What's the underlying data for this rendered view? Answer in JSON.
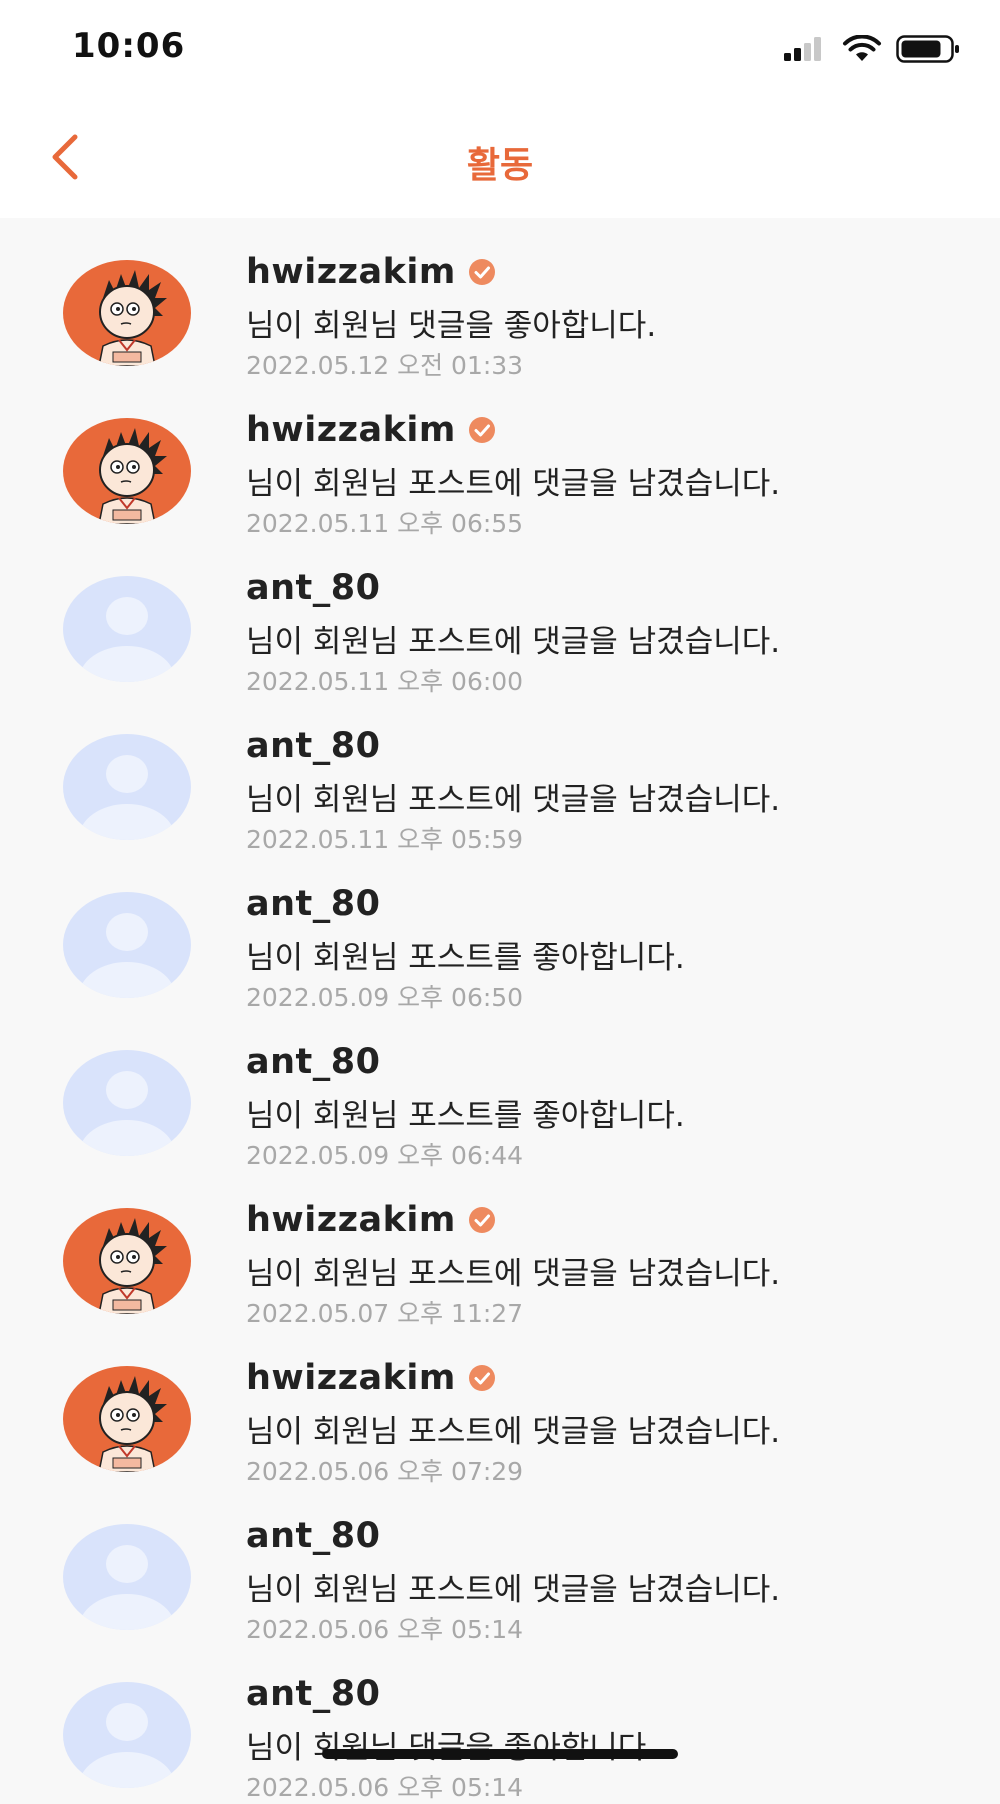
{
  "status_bar": {
    "time": "10:06"
  },
  "header": {
    "title": "활동",
    "back_icon": "chevron-left-icon"
  },
  "colors": {
    "accent": "#e8693a",
    "default_avatar_bg": "#d9e3fb",
    "default_avatar_fg": "#edf2fd"
  },
  "activities": [
    {
      "username": "hwizzakim",
      "verified": true,
      "avatar": "cartoon",
      "message": "님이 회원님 댓글을 좋아합니다.",
      "time": "2022.05.12 오전 01:33"
    },
    {
      "username": "hwizzakim",
      "verified": true,
      "avatar": "cartoon",
      "message": "님이 회원님 포스트에 댓글을 남겼습니다.",
      "time": "2022.05.11 오후 06:55"
    },
    {
      "username": "ant_80",
      "verified": false,
      "avatar": "default",
      "message": "님이 회원님 포스트에 댓글을 남겼습니다.",
      "time": "2022.05.11 오후 06:00"
    },
    {
      "username": "ant_80",
      "verified": false,
      "avatar": "default",
      "message": "님이 회원님 포스트에 댓글을 남겼습니다.",
      "time": "2022.05.11 오후 05:59"
    },
    {
      "username": "ant_80",
      "verified": false,
      "avatar": "default",
      "message": "님이 회원님 포스트를 좋아합니다.",
      "time": "2022.05.09 오후 06:50"
    },
    {
      "username": "ant_80",
      "verified": false,
      "avatar": "default",
      "message": "님이 회원님 포스트를 좋아합니다.",
      "time": "2022.05.09 오후 06:44"
    },
    {
      "username": "hwizzakim",
      "verified": true,
      "avatar": "cartoon",
      "message": "님이 회원님 포스트에 댓글을 남겼습니다.",
      "time": "2022.05.07 오후 11:27"
    },
    {
      "username": "hwizzakim",
      "verified": true,
      "avatar": "cartoon",
      "message": "님이 회원님 포스트에 댓글을 남겼습니다.",
      "time": "2022.05.06 오후 07:29"
    },
    {
      "username": "ant_80",
      "verified": false,
      "avatar": "default",
      "message": "님이 회원님 포스트에 댓글을 남겼습니다.",
      "time": "2022.05.06 오후 05:14"
    },
    {
      "username": "ant_80",
      "verified": false,
      "avatar": "default",
      "message": "님이 회원님 댓글을 좋아합니다.",
      "time": "2022.05.06 오후 05:14"
    }
  ]
}
